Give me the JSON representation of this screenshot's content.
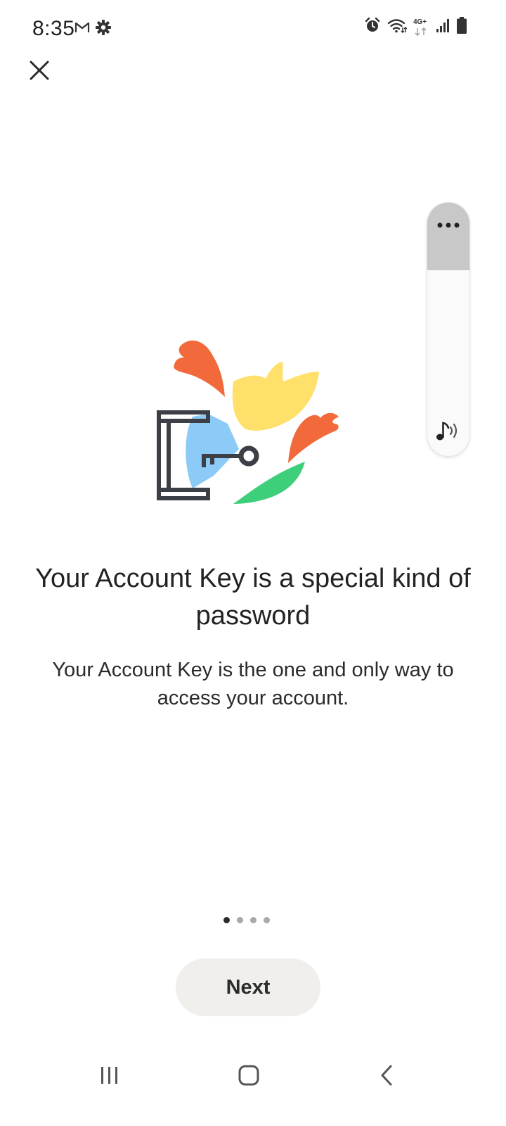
{
  "status_bar": {
    "time": "8:35",
    "network_label": "4G+",
    "left_icons": [
      "gmail-icon",
      "settings-gear-icon"
    ],
    "right_icons": [
      "alarm-icon",
      "wifi-icon",
      "mobile-data-icon",
      "signal-icon",
      "battery-icon"
    ]
  },
  "close": {
    "icon": "close-icon"
  },
  "volume_panel": {
    "more_icon": "more-options-icon",
    "sound_icon": "media-volume-icon"
  },
  "illustration": {
    "icon": "account-key-illustration",
    "colors": {
      "orange": "#f26a3b",
      "yellow": "#ffe06b",
      "blue": "#8ccbf7",
      "green": "#3ecf7a",
      "outline": "#3c3f45"
    }
  },
  "content": {
    "title": "Your Account Key is a special kind of password",
    "subtitle": "Your Account Key is the one and only way to access your account."
  },
  "pager": {
    "total": 4,
    "current": 1
  },
  "actions": {
    "next_label": "Next"
  },
  "nav_bar": {
    "icons": [
      "recent-apps-icon",
      "home-icon",
      "back-icon"
    ]
  }
}
